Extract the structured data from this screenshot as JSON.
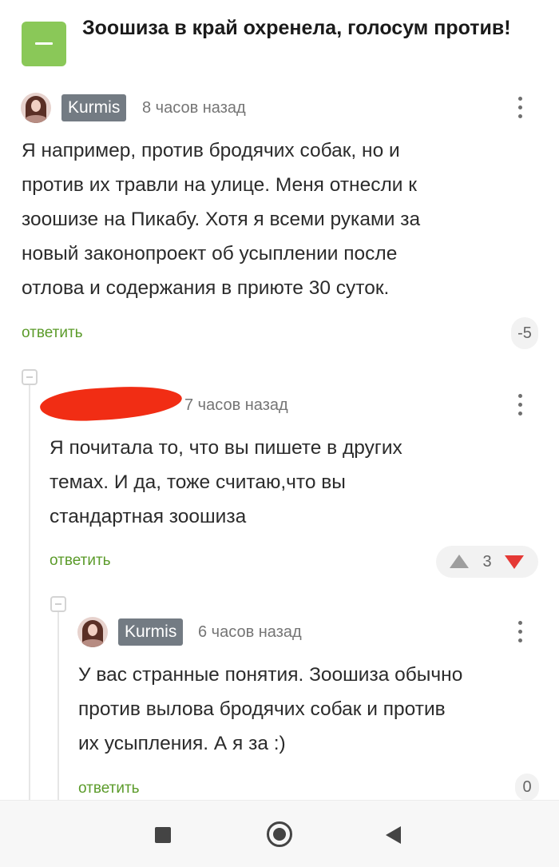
{
  "post": {
    "title": "Зоошиза в край охренела, голосум против!"
  },
  "comments": [
    {
      "author": "Kurmis",
      "time": "8 часов назад",
      "lines": [
        "Я например, против бродячих собак, но и",
        "против их травли на улице. Меня отнесли к",
        "зоошизе на Пикабу. Хотя я всеми руками за",
        "новый законопроект об усыплении после",
        "отлова и содержания в приюте 30 суток."
      ],
      "reply_label": "ответить",
      "rating": "-5"
    },
    {
      "author": "",
      "time": "7 часов назад",
      "lines": [
        "Я почитала то, что вы пишете в других",
        "темах. И да, тоже считаю,что вы",
        "стандартная зоошиза"
      ],
      "reply_label": "ответить",
      "rating": "3"
    },
    {
      "author": "Kurmis",
      "time": "6 часов назад",
      "lines": [
        "У вас странные понятия. Зоошиза обычно",
        "против вылова бродячих собак и против",
        "их усыпления. А я за :)"
      ],
      "reply_label": "ответить",
      "rating": "0"
    }
  ],
  "icons": {
    "collapse": "minus-square-icon",
    "menu": "kebab-menu-icon",
    "upvote": "triangle-up-icon",
    "downvote": "triangle-down-icon",
    "nav": [
      "square-recents-icon",
      "circle-home-icon",
      "triangle-back-icon"
    ]
  },
  "colors": {
    "accent_green": "#8ac858",
    "reply_green": "#5b9b2a",
    "downvote_red": "#e53935",
    "nick_bg": "#737b83"
  }
}
